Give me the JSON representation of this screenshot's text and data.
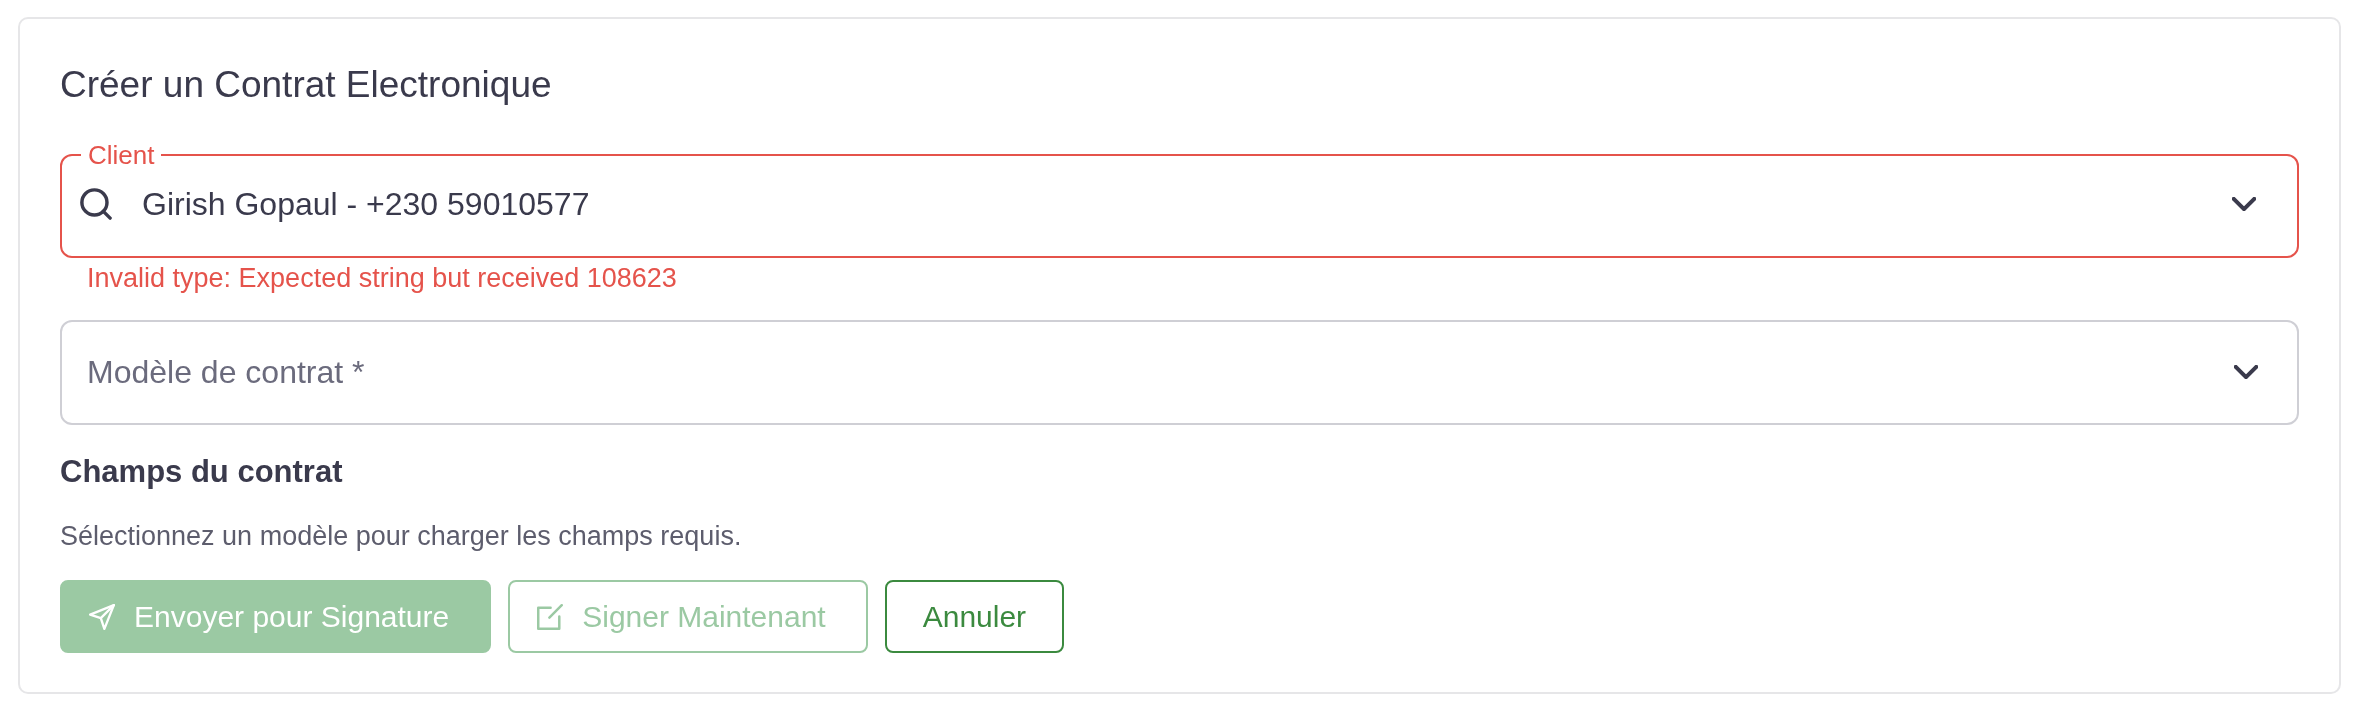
{
  "form": {
    "title": "Créer un Contrat Electronique",
    "client_field": {
      "label": "Client",
      "value": "Girish Gopaul - +230 59010577",
      "invalid": true,
      "error": "Invalid type: Expected string but received 108623"
    },
    "template_field": {
      "placeholder": "Modèle de contrat *"
    },
    "section": {
      "title": "Champs du contrat",
      "hint": "Sélectionnez un modèle pour charger les champs requis."
    },
    "buttons": [
      {
        "label": "Envoyer pour Signature",
        "kind": "send",
        "disabled": true
      },
      {
        "label": "Signer Maintenant",
        "kind": "sign",
        "disabled": true
      },
      {
        "label": "Annuler",
        "kind": "cancel",
        "disabled": false
      }
    ]
  }
}
